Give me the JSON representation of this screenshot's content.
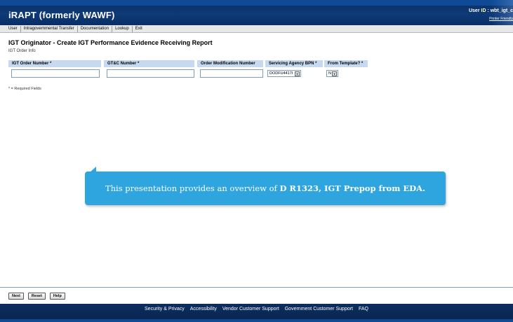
{
  "header": {
    "app_title": "iRAPT (formerly WAWF)",
    "user_id": "User ID : wbt_igt_c",
    "printer_link": "Printer Friendly"
  },
  "menu": {
    "items": [
      "User",
      "Intragovernmental Transfer",
      "Documentation",
      "Lookup",
      "Exit"
    ]
  },
  "page": {
    "title": "IGT Originator - Create IGT Performance Evidence Receiving Report",
    "section": "IGT Order Info",
    "required_note": "* = Required Fields"
  },
  "form": {
    "columns": [
      "IGT Order Number *",
      "GT&C Number *",
      "Order Modification Number",
      "Servicing Agency BPN *",
      "From Template? *"
    ],
    "servicing_agency_bpn_value": "DODFU4417I",
    "from_template_value": "N"
  },
  "callout": {
    "text_prefix": "This presentation provides an overview of ",
    "text_bold": "D R1323, IGT Prepop from EDA."
  },
  "buttons": {
    "next": "Next",
    "reset": "Reset",
    "help": "Help"
  },
  "footer": {
    "links": [
      "Security & Privacy",
      "Accessibility",
      "Vendor Customer Support",
      "Government Customer Support",
      "FAQ"
    ]
  },
  "colors": {
    "header_bg": "#0b2d5e",
    "column_header_bg": "#c6d9ef",
    "callout_bg": "#2fa5e0"
  }
}
